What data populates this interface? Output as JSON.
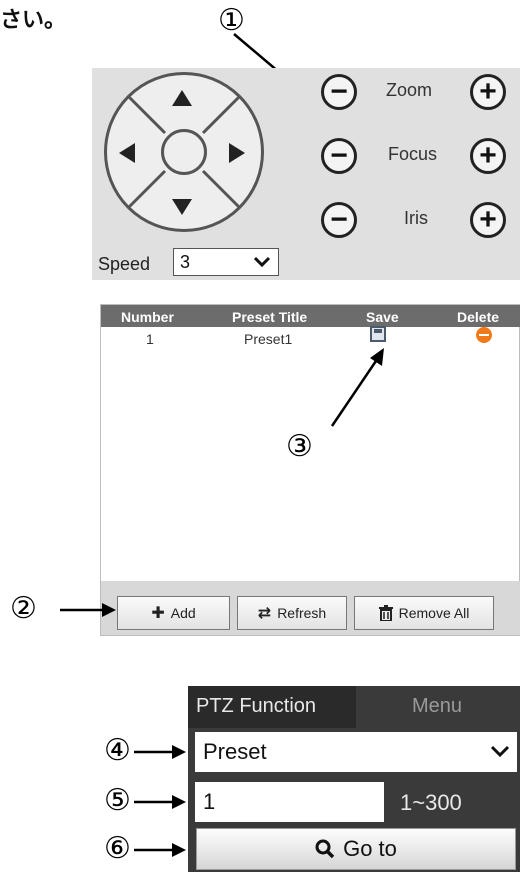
{
  "intro": {
    "text": "さい。"
  },
  "annotations": {
    "a1": "①",
    "a2": "②",
    "a3": "③",
    "a4": "④",
    "a5": "⑤",
    "a6": "⑥"
  },
  "ptz": {
    "zoom_label": "Zoom",
    "focus_label": "Focus",
    "iris_label": "Iris",
    "minus": "−",
    "plus": "+",
    "speed_label": "Speed",
    "speed_value": "3"
  },
  "preset_table": {
    "columns": [
      "Number",
      "Preset Title",
      "Save",
      "Delete"
    ],
    "rows": [
      {
        "number": "1",
        "title": "Preset1"
      }
    ]
  },
  "footer_buttons": {
    "add": "Add",
    "refresh": "Refresh",
    "remove_all": "Remove All"
  },
  "ptz_function": {
    "tab_active": "PTZ Function",
    "tab_menu": "Menu",
    "mode_value": "Preset",
    "number_value": "1",
    "range": "1~300",
    "goto_label": "Go to"
  },
  "colors": {
    "header_bg": "#6c6c6c",
    "delete_orange": "#f07a1a",
    "dark_panel": "#3a3a3a"
  },
  "icons": [
    "arrow-up-icon",
    "arrow-down-icon",
    "arrow-left-icon",
    "arrow-right-icon",
    "minus-icon",
    "plus-icon",
    "chevron-down-icon",
    "save-icon",
    "delete-icon",
    "add-icon",
    "refresh-icon",
    "trash-icon",
    "search-icon"
  ]
}
